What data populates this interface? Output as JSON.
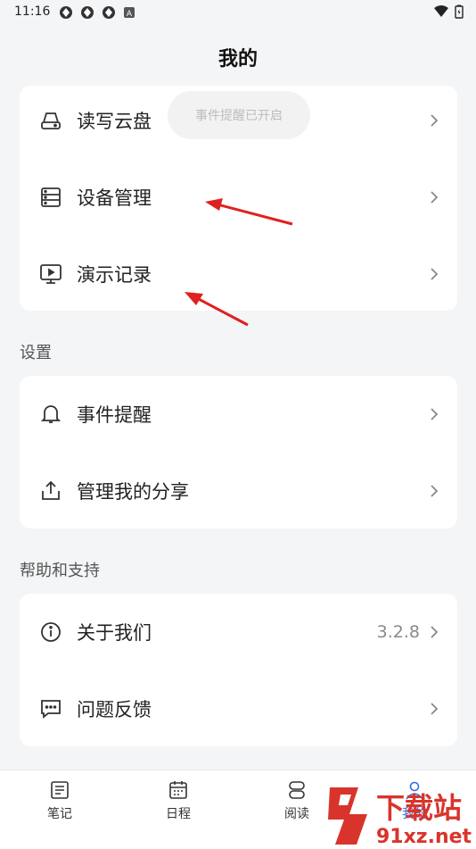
{
  "status_bar": {
    "time": "11:16"
  },
  "header": {
    "title": "我的"
  },
  "toast": {
    "text": "事件提醒已开启"
  },
  "card1": {
    "items": [
      {
        "label": "读写云盘",
        "icon": "cloud-drive-icon"
      },
      {
        "label": "设备管理",
        "icon": "device-list-icon"
      },
      {
        "label": "演示记录",
        "icon": "presentation-icon"
      }
    ]
  },
  "settings": {
    "title": "设置",
    "items": [
      {
        "label": "事件提醒",
        "icon": "bell-icon"
      },
      {
        "label": "管理我的分享",
        "icon": "share-icon"
      }
    ]
  },
  "help": {
    "title": "帮助和支持",
    "items": [
      {
        "label": "关于我们",
        "icon": "info-icon",
        "value": "3.2.8"
      },
      {
        "label": "问题反馈",
        "icon": "feedback-icon"
      }
    ]
  },
  "tabs": [
    {
      "label": "笔记",
      "icon": "note-icon"
    },
    {
      "label": "日程",
      "icon": "calendar-icon"
    },
    {
      "label": "阅读",
      "icon": "reading-icon"
    },
    {
      "label": "我的",
      "icon": "profile-icon"
    }
  ],
  "watermark": {
    "text_cn": "下载站",
    "text_url": "91xz.net"
  },
  "colors": {
    "annotation_arrow": "#e02020",
    "background": "#f4f5f7"
  }
}
